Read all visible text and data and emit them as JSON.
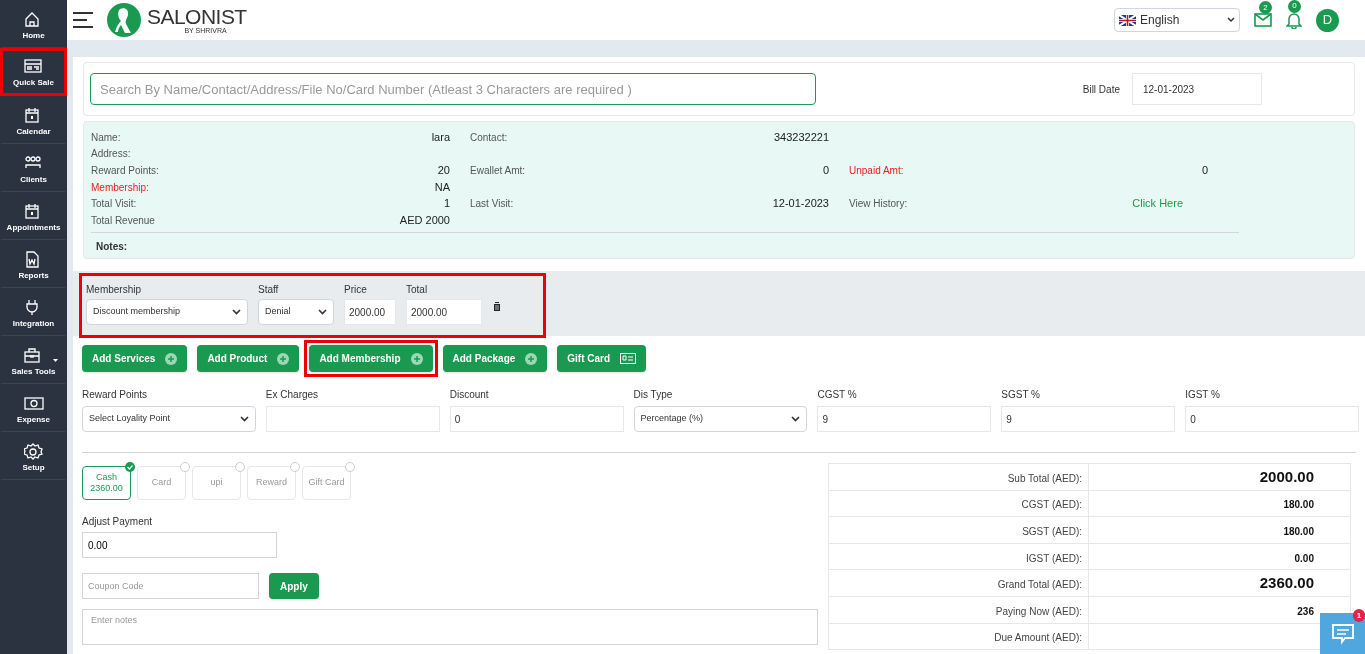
{
  "sidebar": {
    "items": [
      {
        "label": "Home",
        "highlighted": false
      },
      {
        "label": "Quick Sale",
        "highlighted": true
      },
      {
        "label": "Calendar",
        "highlighted": false
      },
      {
        "label": "Clients",
        "highlighted": false
      },
      {
        "label": "Appointments",
        "highlighted": false
      },
      {
        "label": "Reports",
        "highlighted": false
      },
      {
        "label": "Integration",
        "highlighted": false
      },
      {
        "label": "Sales Tools",
        "highlighted": false
      },
      {
        "label": "Expense",
        "highlighted": false
      },
      {
        "label": "Setup",
        "highlighted": false
      }
    ]
  },
  "header": {
    "brand": "SALONIST",
    "tagline": "BY SHRIVRA",
    "language": "English",
    "mail_count": "2",
    "notification_count": "0",
    "avatar": "D"
  },
  "search": {
    "placeholder": "Search By Name/Contact/Address/File No/Card Number (Atleast 3 Characters are required )",
    "bill_date_label": "Bill Date",
    "bill_date": "12-01-2023"
  },
  "client_info": {
    "rows": [
      [
        {
          "label": "Name:",
          "value": "lara",
          "alert": false,
          "link": false
        },
        {
          "label": "Contact:",
          "value": "343232221",
          "alert": false,
          "link": false
        },
        null
      ],
      [
        {
          "label": "Address:",
          "alert": false
        },
        null,
        null
      ],
      [
        {
          "label": "Reward Points:",
          "value": "20",
          "alert": false,
          "link": false
        },
        {
          "label": "Ewallet Amt:",
          "value": "0",
          "alert": false,
          "link": false
        },
        {
          "label": "Unpaid Amt:",
          "value": "0",
          "alert": true,
          "link": false
        }
      ],
      [
        {
          "label": "Membership:",
          "value": "NA",
          "alert": true,
          "link": false
        },
        null,
        null
      ],
      [
        {
          "label": "Total Visit:",
          "value": "1",
          "alert": false,
          "link": false
        },
        {
          "label": "Last Visit:",
          "value": "12-01-2023",
          "alert": false,
          "link": false
        },
        {
          "label": "View History:",
          "value": "Click Here",
          "alert": false,
          "link": true
        }
      ],
      [
        {
          "label": "Total Revenue",
          "value": "AED 2000",
          "alert": false,
          "link": false
        },
        null,
        null
      ]
    ],
    "notes_label": "Notes:"
  },
  "membership_row": {
    "highlighted": true,
    "membership_label": "Membership",
    "membership": "Discount membership",
    "staff_label": "Staff",
    "staff": "Denial",
    "price_label": "Price",
    "price": "2000.00",
    "total_label": "Total",
    "total": "2000.00"
  },
  "add_buttons": [
    {
      "label": "Add Services",
      "kind": "plus",
      "highlighted": false
    },
    {
      "label": "Add Product",
      "kind": "plus",
      "highlighted": false
    },
    {
      "label": "Add Membership",
      "kind": "plus",
      "highlighted": true
    },
    {
      "label": "Add Package",
      "kind": "plus",
      "highlighted": false
    },
    {
      "label": "Gift Card",
      "kind": "card",
      "highlighted": false
    }
  ],
  "fields": [
    {
      "label": "Reward Points",
      "kind": "select",
      "value": "Select Loyality Point"
    },
    {
      "label": "Ex Charges",
      "kind": "input"
    },
    {
      "label": "Discount",
      "kind": "input",
      "value": "0"
    },
    {
      "label": "Dis Type",
      "kind": "select",
      "value": "Percentage (%)"
    },
    {
      "label": "CGST %",
      "kind": "input",
      "value": "9"
    },
    {
      "label": "SGST %",
      "kind": "input",
      "value": "9"
    },
    {
      "label": "IGST %",
      "kind": "input",
      "value": "0"
    }
  ],
  "payment_modes": [
    {
      "label": "Cash",
      "amount": "2360.00",
      "selected": true
    },
    {
      "label": "Card",
      "selected": false
    },
    {
      "label": "upi",
      "selected": false
    },
    {
      "label": "Reward",
      "selected": false
    },
    {
      "label": "Gift Card",
      "selected": false
    }
  ],
  "adjust_payment": {
    "label": "Adjust Payment",
    "value": "0.00"
  },
  "coupon": {
    "placeholder": "Coupon Code",
    "button": "Apply"
  },
  "notes": {
    "placeholder": "Enter notes"
  },
  "summary": [
    {
      "label": "Sub Total (AED):",
      "value": "2000.00",
      "emphasis": true
    },
    {
      "label": "CGST (AED):",
      "value": "180.00",
      "emphasis": false
    },
    {
      "label": "SGST (AED):",
      "value": "180.00",
      "emphasis": false
    },
    {
      "label": "IGST (AED):",
      "value": "0.00",
      "emphasis": false
    },
    {
      "label": "Grand Total (AED):",
      "value": "2360.00",
      "emphasis": true
    },
    {
      "label": "Paying Now (AED):",
      "value": "236",
      "emphasis": false
    },
    {
      "label": "Due Amount (AED):"
    }
  ],
  "chat": {
    "badge": "1"
  }
}
